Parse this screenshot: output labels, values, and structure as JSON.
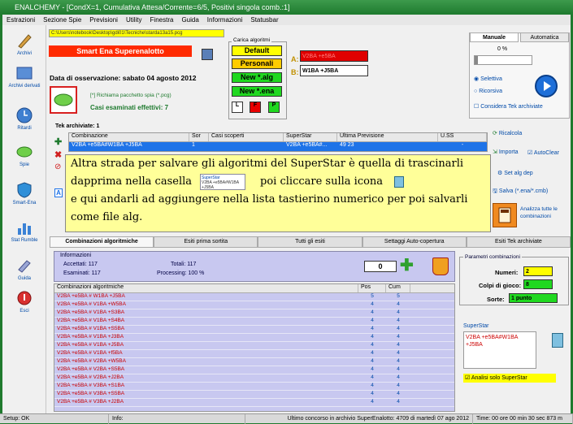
{
  "window": {
    "title": "ENALCHEMY - [CondX=1, Cumulativa Attesa/Corrente=6/5, Positivi singola comb.:1]"
  },
  "menu": [
    "Estrazioni",
    "Sezione Spie",
    "Previsioni",
    "Utility",
    "Finestra",
    "Guida",
    "Informazioni",
    "Statusbar"
  ],
  "left_nav": [
    {
      "label": "Archivi"
    },
    {
      "label": "Archivi derivati"
    },
    {
      "label": "Ritardi"
    },
    {
      "label": "Spie"
    },
    {
      "label": "Smart-Ena"
    },
    {
      "label": "Stat Rumble"
    },
    {
      "label": "Guida"
    },
    {
      "label": "Esci"
    }
  ],
  "path": "C:\\Users\\notebook\\Desktop\\gdi01\\Tecniche\\starda13a15.pcg",
  "app_name": "Smart Ena Superenalotto",
  "observation_date": "Data di osservazione:  sabato 04 agosto 2012",
  "reload_spy": "[*] Richiama pacchetto spia (*.pcg)",
  "cases_examined": "Casi esaminati effettivi: 7",
  "algo_group": {
    "title": "Carica algoritmi",
    "buttons": [
      "Default",
      "Personali",
      "New *.alg",
      "New *.ena"
    ],
    "small": [
      "L",
      "F",
      "P"
    ],
    "a_label": "A:",
    "a_value": "V2BA +e5BA",
    "b_label": "B:",
    "b_value": "W1BA +J5BA"
  },
  "mode_tabs": {
    "manual": "Manuale",
    "auto": "Automatica"
  },
  "slider_value": "0 %",
  "radio": {
    "selected": "Selettiva",
    "other": "Ricorsiva"
  },
  "consider_tek": "Considera Tek archiviate",
  "tek_table": {
    "title": "Tek archiviate: 1",
    "columns": [
      "Combinazione",
      "Sor",
      "Casi scoperti",
      "SuperStar",
      "Ultima Previsione",
      "U.SS"
    ],
    "rows": [
      [
        "V2BA +e5BA#W1BA +J5BA",
        "1",
        "",
        "V2BA +e5BA#...",
        "49 23",
        "-"
      ]
    ]
  },
  "right_actions": {
    "recalc": "Ricalcola",
    "import": "Importa",
    "autoclear": "AutoClear",
    "set_alg": "Set alg dep",
    "save": "Salva (*.ena/*.cmb)",
    "analyze": "Analizza tutte le combinazioni"
  },
  "note": {
    "line1": "Altra strada per salvare gli algoritmi del SuperStar è quella di trascinarli",
    "line2a": "dapprima nella casella",
    "line2b": "poi cliccare sulla icona",
    "line3": "e qui andarli ad aggiungere nella lista tastierino numerico per poi salvarli",
    "line4": "come file alg.",
    "mini_title": "SuperStar",
    "mini_text": "V2BA +e5BA#W1BA +J5BA"
  },
  "bottom_tabs": [
    "Combinazioni algoritmiche",
    "Esiti prima sortita",
    "Tutti gli esiti",
    "Settaggi Auto-copertura",
    "Esiti Tek archiviate"
  ],
  "info": {
    "title": "Informazioni",
    "accettati": "Accettati:  117",
    "esaminati": "Esaminati: 117",
    "totali": "Totali:  117",
    "processing": "Processing:  100 %",
    "counter": "0"
  },
  "combos": {
    "columns": [
      "Combinazioni algoritmiche",
      "Pos",
      "Cum"
    ],
    "rows": [
      [
        "V2BA +e5BA # W1BA +J5BA",
        "5",
        "5"
      ],
      [
        "V2BA +e5BA # V1BA +W5BA",
        "4",
        "4"
      ],
      [
        "V2BA +e5BA # V1BA +S3BA",
        "4",
        "4"
      ],
      [
        "V2BA +e5BA # V1BA +S4BA",
        "4",
        "4"
      ],
      [
        "V2BA +e5BA # V1BA +S5BA",
        "4",
        "4"
      ],
      [
        "V2BA +e5BA # V1BA +J3BA",
        "4",
        "4"
      ],
      [
        "V2BA +e5BA # V1BA +J5BA",
        "4",
        "4"
      ],
      [
        "V2BA +e5BA # V1BA +f5BA",
        "4",
        "4"
      ],
      [
        "V2BA +e5BA # V2BA +W5BA",
        "4",
        "4"
      ],
      [
        "V2BA +e5BA # V2BA +S5BA",
        "4",
        "4"
      ],
      [
        "V2BA +e5BA # V2BA +J2BA",
        "4",
        "4"
      ],
      [
        "V2BA +e5BA # V3BA +S1BA",
        "4",
        "4"
      ],
      [
        "V2BA +e5BA # V3BA +S5BA",
        "4",
        "4"
      ],
      [
        "V2BA +e5BA # V3BA +J2BA",
        "4",
        "4"
      ]
    ]
  },
  "params": {
    "title": "Parametri combinazioni",
    "numeri_label": "Numeri:",
    "numeri": "2",
    "colpi_label": "Colpi di gioco:",
    "colpi": "8",
    "sorte_label": "Sorte:",
    "sorte": "1 punto"
  },
  "superstar_box": {
    "title": "SuperStar",
    "value": "V2BA +e5BA#W1BA +J5BA",
    "analisi": "Analisi solo SuperStar"
  },
  "status": {
    "setup": "Setup: OK",
    "info": "Info:",
    "last": "Ultimo concorso in archivio SuperEnalotto: 4709 di martedì 07 ago 2012",
    "time": "Time: 00 ore 00 min 30 sec 873 m"
  },
  "colors": {
    "accent_green": "#1f7a2e",
    "highlight_yellow": "#ffff00",
    "selection_blue": "#1e73e8",
    "red": "#ff2a00"
  }
}
